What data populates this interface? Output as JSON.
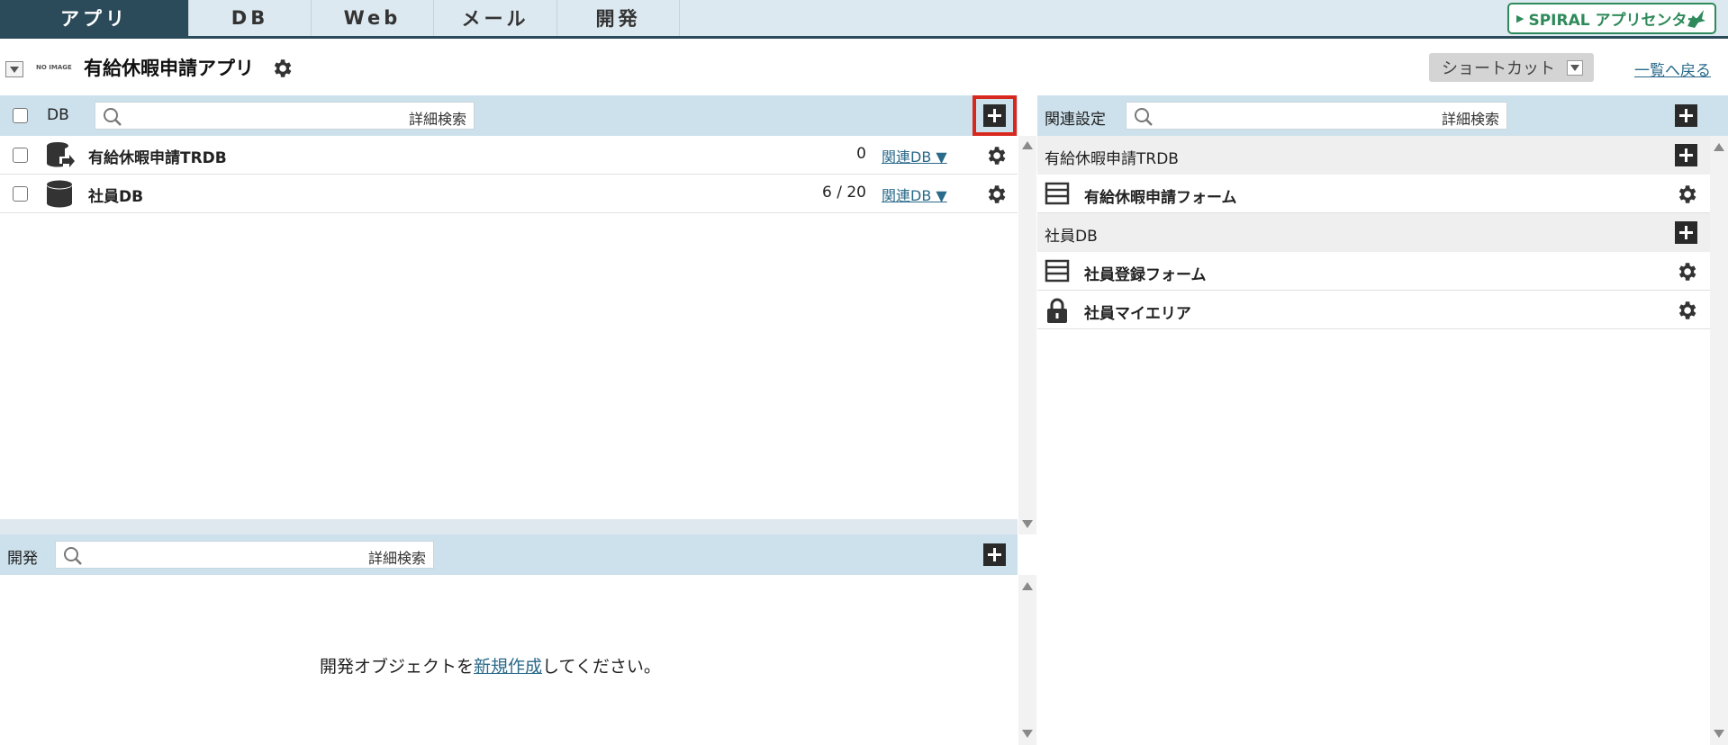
{
  "nav": {
    "tabs": [
      {
        "label": "アプリ",
        "active": true
      },
      {
        "label": "DB",
        "active": false
      },
      {
        "label": "Web",
        "active": false
      },
      {
        "label": "メール",
        "active": false
      },
      {
        "label": "開発",
        "active": false
      }
    ],
    "spiral_label": "SPIRAL アプリセンター"
  },
  "header": {
    "no_image": "NO IMAGE",
    "app_title": "有給休暇申請アプリ",
    "shortcut_label": "ショートカット",
    "back_link": "一覧へ戻る"
  },
  "db_panel": {
    "label": "DB",
    "search_placeholder": "",
    "advanced_search": "詳細検索",
    "rows": [
      {
        "name": "有給休暇申請TRDB",
        "count": "0",
        "related": "関連DB ▼",
        "icon": "transaction-db-icon"
      },
      {
        "name": "社員DB",
        "count": "6 / 20",
        "related": "関連DB ▼",
        "icon": "database-icon"
      }
    ]
  },
  "dev_panel": {
    "label": "開発",
    "advanced_search": "詳細検索",
    "empty_prefix": "開発オブジェクトを",
    "empty_link": "新規作成",
    "empty_suffix": "してください。"
  },
  "related_panel": {
    "label": "関連設定",
    "advanced_search": "詳細検索",
    "groups": [
      {
        "name": "有給休暇申請TRDB",
        "items": [
          {
            "name": "有給休暇申請フォーム",
            "icon": "form-icon"
          }
        ]
      },
      {
        "name": "社員DB",
        "items": [
          {
            "name": "社員登録フォーム",
            "icon": "form-icon"
          },
          {
            "name": "社員マイエリア",
            "icon": "lock-icon"
          }
        ]
      }
    ]
  },
  "colors": {
    "nav_active": "#2b4a5a",
    "bar_bg": "#cde1ec",
    "link": "#2a6a8a",
    "highlight": "#d8281e",
    "spiral_green": "#2e8a5a"
  }
}
